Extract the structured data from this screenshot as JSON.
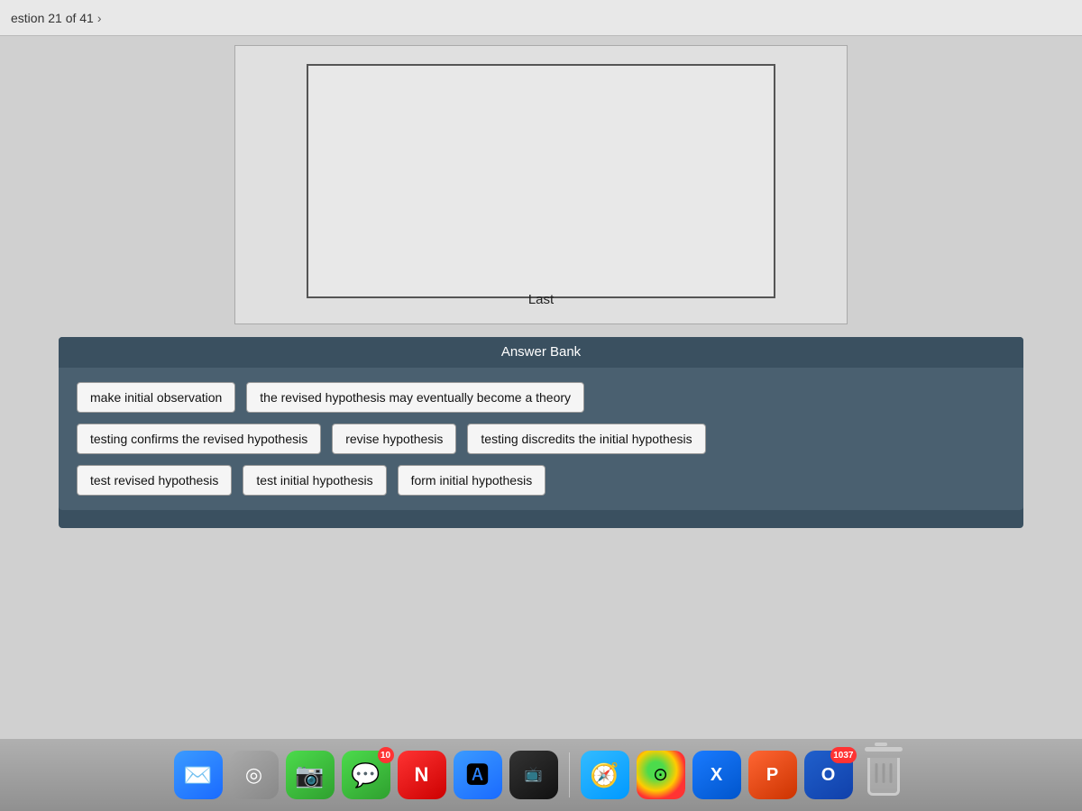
{
  "nav": {
    "question_label": "estion 21 of 41",
    "chevron": "›"
  },
  "diagram": {
    "last_label": "Last"
  },
  "answer_bank": {
    "title": "Answer Bank",
    "rows": [
      [
        {
          "id": "make-initial-observation",
          "text": "make initial observation"
        },
        {
          "id": "revised-hypothesis-theory",
          "text": "the revised hypothesis may eventually become a theory"
        }
      ],
      [
        {
          "id": "testing-confirms",
          "text": "testing confirms the revised hypothesis"
        },
        {
          "id": "revise-hypothesis",
          "text": "revise hypothesis"
        },
        {
          "id": "testing-discredits",
          "text": "testing discredits the initial hypothesis"
        }
      ],
      [
        {
          "id": "test-revised-hypothesis",
          "text": "test revised hypothesis"
        },
        {
          "id": "test-initial-hypothesis",
          "text": "test initial hypothesis"
        },
        {
          "id": "form-initial-hypothesis",
          "text": "form initial hypothesis"
        }
      ]
    ]
  },
  "dock": {
    "items": [
      {
        "id": "mail",
        "label": "Mail",
        "badge": null
      },
      {
        "id": "siri",
        "label": "Siri",
        "badge": null
      },
      {
        "id": "facetime",
        "label": "FaceTime",
        "badge": null
      },
      {
        "id": "messages",
        "label": "Messages",
        "badge": "10"
      },
      {
        "id": "news",
        "label": "News",
        "badge": null
      },
      {
        "id": "store",
        "label": "App Store",
        "badge": null
      },
      {
        "id": "appletv",
        "label": "Apple TV",
        "badge": null
      },
      {
        "id": "safari",
        "label": "Safari",
        "badge": null
      },
      {
        "id": "chrome",
        "label": "Chrome",
        "badge": null
      },
      {
        "id": "xcode",
        "label": "Xcode",
        "badge": null
      },
      {
        "id": "powerpoint",
        "label": "PowerPoint",
        "badge": null
      },
      {
        "id": "outlook",
        "label": "Outlook",
        "badge": "1037"
      },
      {
        "id": "trash",
        "label": "Trash",
        "badge": null
      }
    ]
  }
}
